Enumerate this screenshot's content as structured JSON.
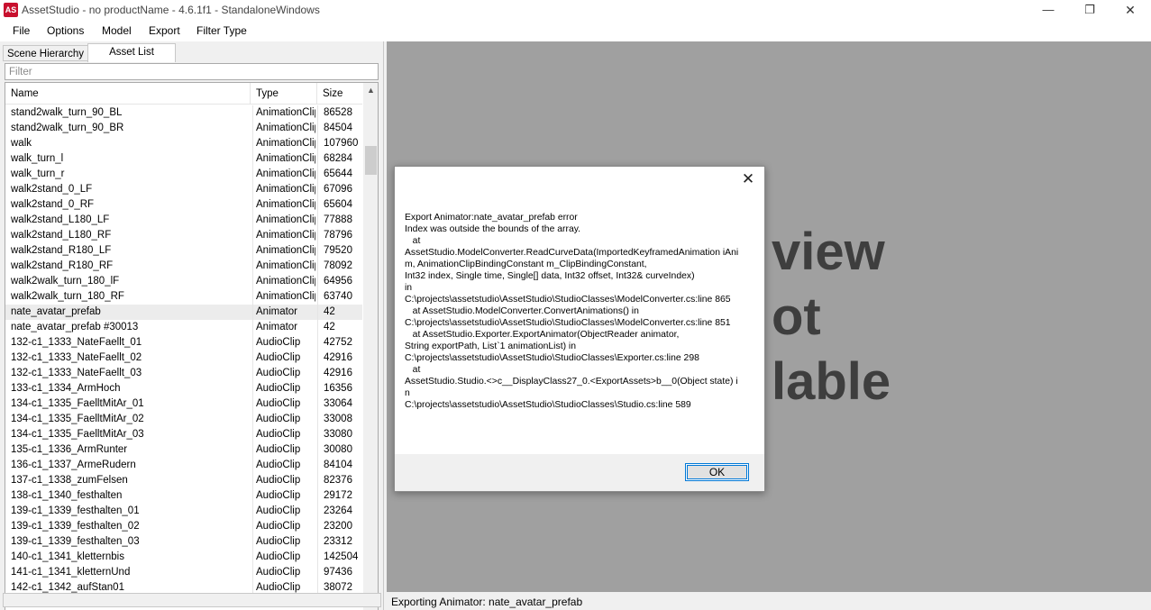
{
  "window": {
    "title": "AssetStudio - no productName - 4.6.1f1 - StandaloneWindows",
    "app_icon_text": "AS",
    "minimize_glyph": "—",
    "maximize_glyph": "❐",
    "close_glyph": "✕"
  },
  "menu": [
    "File",
    "Options",
    "Model",
    "Export",
    "Filter Type"
  ],
  "tabs": [
    "Scene Hierarchy",
    "Asset List"
  ],
  "filter": {
    "placeholder": "Filter",
    "value": ""
  },
  "columns": {
    "name": "Name",
    "type": "Type",
    "size": "Size"
  },
  "rows": [
    {
      "name": "stand2walk_turn_90_BL",
      "type": "AnimationClip",
      "size": "86528"
    },
    {
      "name": "stand2walk_turn_90_BR",
      "type": "AnimationClip",
      "size": "84504"
    },
    {
      "name": "walk",
      "type": "AnimationClip",
      "size": "107960"
    },
    {
      "name": "walk_turn_l",
      "type": "AnimationClip",
      "size": "68284"
    },
    {
      "name": "walk_turn_r",
      "type": "AnimationClip",
      "size": "65644"
    },
    {
      "name": "walk2stand_0_LF",
      "type": "AnimationClip",
      "size": "67096"
    },
    {
      "name": "walk2stand_0_RF",
      "type": "AnimationClip",
      "size": "65604"
    },
    {
      "name": "walk2stand_L180_LF",
      "type": "AnimationClip",
      "size": "77888"
    },
    {
      "name": "walk2stand_L180_RF",
      "type": "AnimationClip",
      "size": "78796"
    },
    {
      "name": "walk2stand_R180_LF",
      "type": "AnimationClip",
      "size": "79520"
    },
    {
      "name": "walk2stand_R180_RF",
      "type": "AnimationClip",
      "size": "78092"
    },
    {
      "name": "walk2walk_turn_180_lF",
      "type": "AnimationClip",
      "size": "64956"
    },
    {
      "name": "walk2walk_turn_180_RF",
      "type": "AnimationClip",
      "size": "63740"
    },
    {
      "name": "nate_avatar_prefab",
      "type": "Animator",
      "size": "42",
      "selected": true
    },
    {
      "name": "nate_avatar_prefab #30013",
      "type": "Animator",
      "size": "42"
    },
    {
      "name": "132-c1_1333_NateFaellt_01",
      "type": "AudioClip",
      "size": "42752"
    },
    {
      "name": "132-c1_1333_NateFaellt_02",
      "type": "AudioClip",
      "size": "42916"
    },
    {
      "name": "132-c1_1333_NateFaellt_03",
      "type": "AudioClip",
      "size": "42916"
    },
    {
      "name": "133-c1_1334_ArmHoch",
      "type": "AudioClip",
      "size": "16356"
    },
    {
      "name": "134-c1_1335_FaelltMitAr_01",
      "type": "AudioClip",
      "size": "33064"
    },
    {
      "name": "134-c1_1335_FaelltMitAr_02",
      "type": "AudioClip",
      "size": "33008"
    },
    {
      "name": "134-c1_1335_FaelltMitAr_03",
      "type": "AudioClip",
      "size": "33080"
    },
    {
      "name": "135-c1_1336_ArmRunter",
      "type": "AudioClip",
      "size": "30080"
    },
    {
      "name": "136-c1_1337_ArmeRudern",
      "type": "AudioClip",
      "size": "84104"
    },
    {
      "name": "137-c1_1338_zumFelsen",
      "type": "AudioClip",
      "size": "82376"
    },
    {
      "name": "138-c1_1340_festhalten",
      "type": "AudioClip",
      "size": "29172"
    },
    {
      "name": "139-c1_1339_festhalten_01",
      "type": "AudioClip",
      "size": "23264"
    },
    {
      "name": "139-c1_1339_festhalten_02",
      "type": "AudioClip",
      "size": "23200"
    },
    {
      "name": "139-c1_1339_festhalten_03",
      "type": "AudioClip",
      "size": "23312"
    },
    {
      "name": "140-c1_1341_kletternbis",
      "type": "AudioClip",
      "size": "142504"
    },
    {
      "name": "141-c1_1341_kletternUnd",
      "type": "AudioClip",
      "size": "97436"
    },
    {
      "name": "142-c1_1342_aufStan01",
      "type": "AudioClip",
      "size": "38072"
    }
  ],
  "scroll": {
    "up_glyph": "▲",
    "down_glyph": "▼"
  },
  "preview_text": [
    "view",
    "ot",
    "lable"
  ],
  "status_text": "Exporting Animator: nate_avatar_prefab",
  "dialog": {
    "close_glyph": "✕",
    "message": "Export Animator:nate_avatar_prefab error\nIndex was outside the bounds of the array.\n   at\nAssetStudio.ModelConverter.ReadCurveData(ImportedKeyframedAnimation iAnim, AnimationClipBindingConstant m_ClipBindingConstant,\nInt32 index, Single time, Single[] data, Int32 offset, Int32& curveIndex)\nin\nC:\\projects\\assetstudio\\AssetStudio\\StudioClasses\\ModelConverter.cs:line 865\n   at AssetStudio.ModelConverter.ConvertAnimations() in\nC:\\projects\\assetstudio\\AssetStudio\\StudioClasses\\ModelConverter.cs:line 851\n   at AssetStudio.Exporter.ExportAnimator(ObjectReader animator,\nString exportPath, List`1 animationList) in\nC:\\projects\\assetstudio\\AssetStudio\\StudioClasses\\Exporter.cs:line 298\n   at\nAssetStudio.Studio.<>c__DisplayClass27_0.<ExportAssets>b__0(Object state) in\nC:\\projects\\assetstudio\\AssetStudio\\StudioClasses\\Studio.cs:line 589",
    "ok_label": "OK"
  }
}
